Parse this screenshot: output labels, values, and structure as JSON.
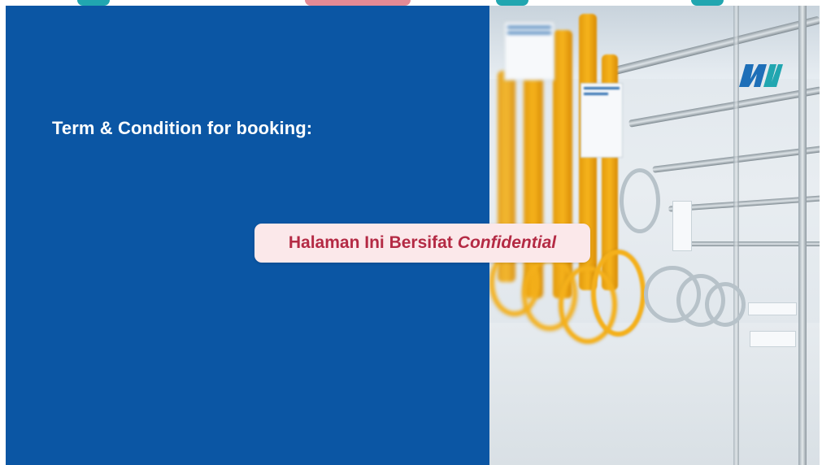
{
  "slide": {
    "heading": "Term & Condition for booking:",
    "confidential_notice": {
      "prefix": "Halaman Ini Bersifat",
      "emphasis": "Confidential"
    },
    "logo_text": "MRT Jakarta"
  },
  "colors": {
    "panel_blue": "#0b56a4",
    "notice_bg": "#fbe8ea",
    "notice_text": "#b42a44",
    "strap_orange": "#f4b01b",
    "top_accent_teal": "#21a6b0",
    "top_accent_pink": "#e48a95"
  }
}
